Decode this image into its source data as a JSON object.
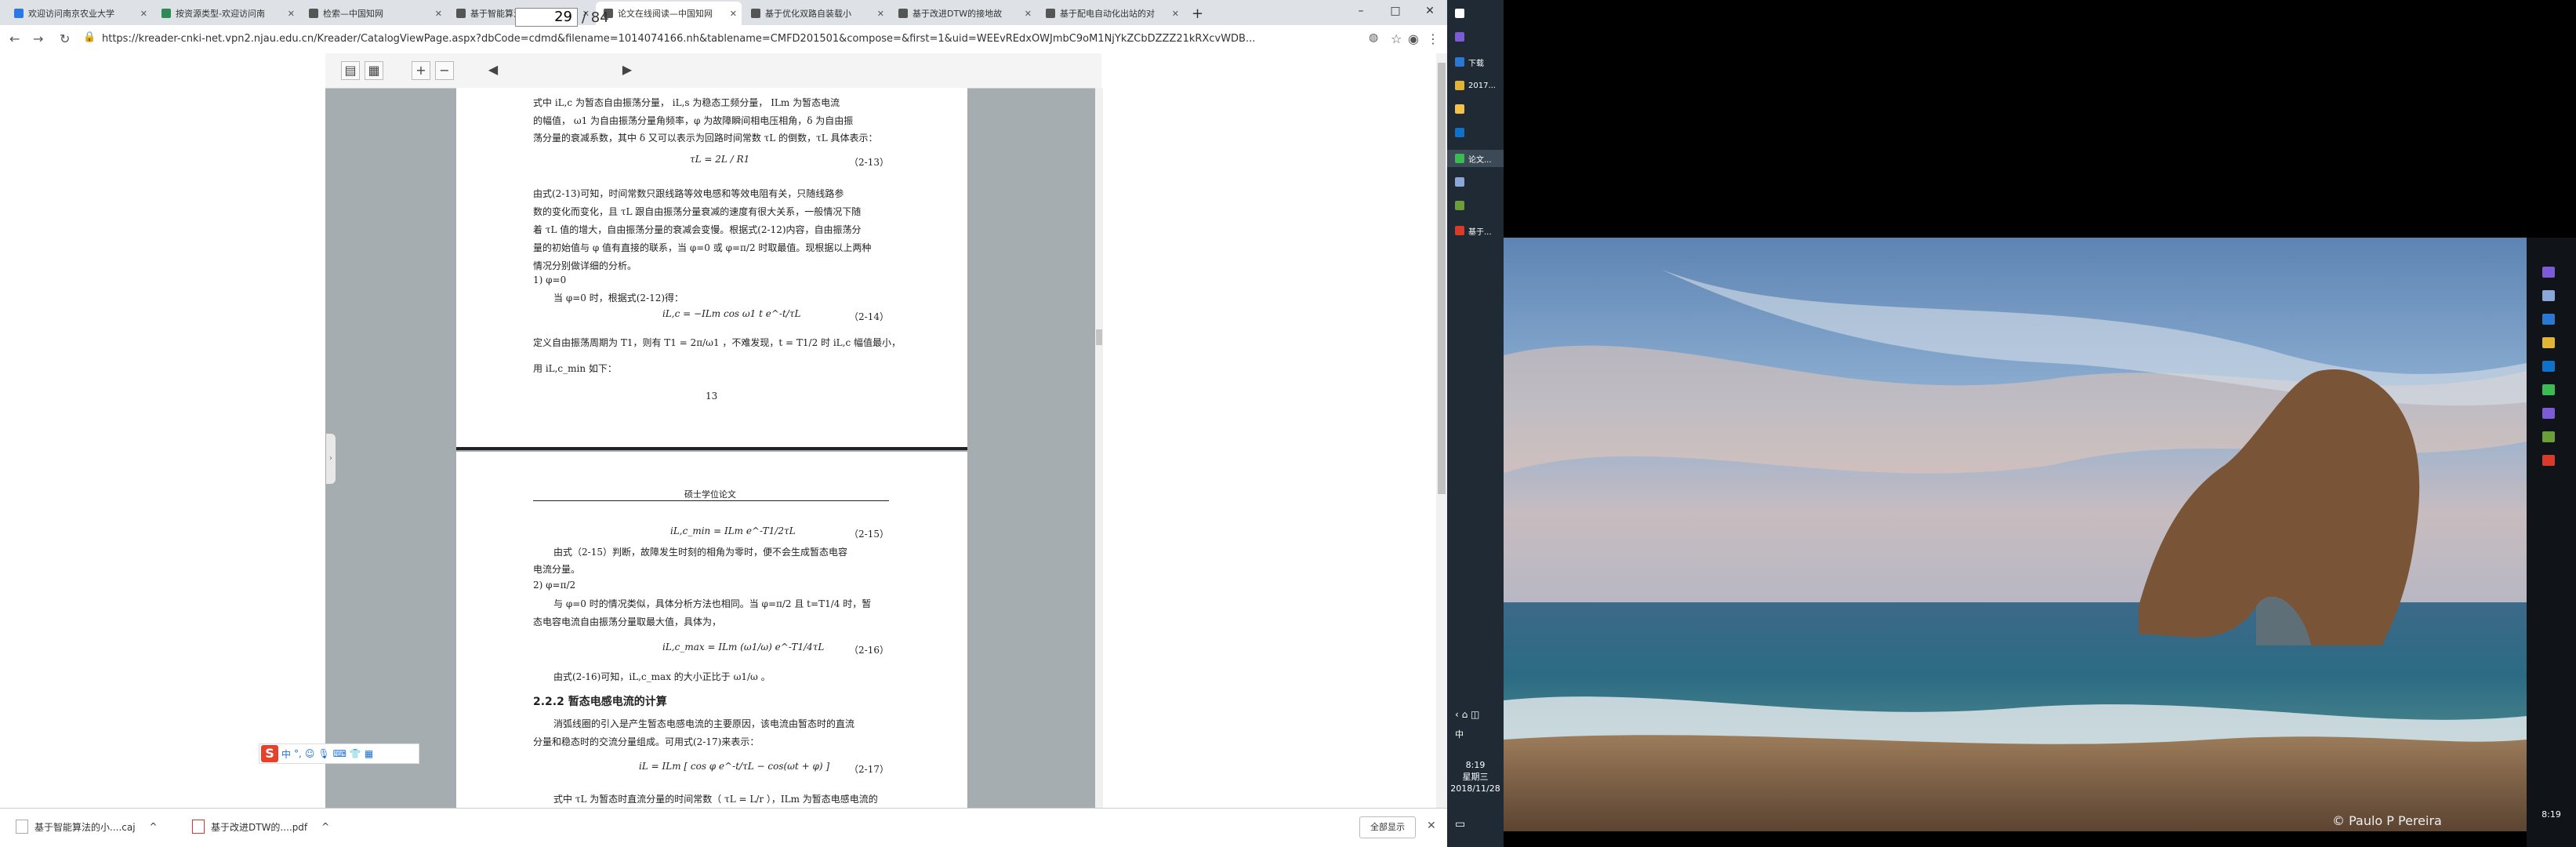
{
  "browser": {
    "tabs": [
      {
        "label": "欢迎访问南京农业大学",
        "color": "#2b78e4"
      },
      {
        "label": "按资源类型-欢迎访问南",
        "color": "#2e8b57"
      },
      {
        "label": "检索—中国知网",
        "color": "#555555"
      },
      {
        "label": "基于智能算法的小电流接",
        "color": "#555555"
      },
      {
        "label": "论文在线阅读—中国知网",
        "color": "#555555",
        "active": true
      },
      {
        "label": "基于优化双路自装载小",
        "color": "#555555"
      },
      {
        "label": "基于改进DTW的接地故",
        "color": "#555555"
      },
      {
        "label": "基于配电自动化出站的对",
        "color": "#555555"
      }
    ],
    "new_tab": "+",
    "window_controls": [
      "–",
      "□",
      "✕"
    ],
    "url": "https://kreader-cnki-net.vpn2.njau.edu.cn/Kreader/CatalogViewPage.aspx?dbCode=cdmd&filename=1014074166.nh&tablename=CMFD201501&compose=&first=1&uid=WEEvREdxOWJmbC9oM1NjYkZCbDZZZ21kRXcvWDB..."
  },
  "reader": {
    "current_page": "29",
    "total_pages": "/ 84"
  },
  "page1": {
    "lines": [
      "式中 iL,c 为暂态自由振荡分量， iL,s 为稳态工频分量， ILm 为暂态电流",
      "的幅值， ω1 为自由振荡分量角频率，φ 为故障瞬间相电压相角，δ 为自由振",
      "荡分量的衰减系数，其中 δ 又可以表示为回路时间常数 τL 的倒数，τL 具体表示：",
      "由式(2-13)可知，时间常数只跟线路等效电感和等效电阻有关，只随线路参",
      "数的变化而变化，且 τL 跟自由振荡分量衰减的速度有很大关系，一般情况下随",
      "着 τL 值的增大，自由振荡分量的衰减会变慢。根据式(2-12)内容，自由振荡分",
      "量的初始值与 φ 值有直接的联系，当 φ=0 或 φ=π/2 时取最值。现根据以上两种",
      "情况分别做详细的分析。",
      "1)    φ=0",
      "当 φ=0 时，根据式(2-12)得：",
      "定义自由振荡周期为 T1，则有 T1 = 2π/ω1 ，不难发现，t = T1/2 时 iL,c 幅值最小，",
      "用 iL,c_min 如下："
    ],
    "eq13": "τL = 2L / R1",
    "eq13_no": "（2-13）",
    "eq14": "iL,c = −ILm cos ω1 t e^-t/τL",
    "eq14_no": "（2-14）",
    "page_number": "13"
  },
  "page2": {
    "header": "硕士学位论文",
    "eq15": "iL,c_min = ILm e^-T1/2τL",
    "eq15_no": "（2-15）",
    "lines": [
      "由式（2-15）判断，故障发生时刻的相角为零时，便不会生成暂态电容",
      "电流分量。",
      "2)    φ=π/2",
      "与 φ=0 时的情况类似，具体分析方法也相同。当 φ=π/2 且 t=T1/4 时，暂",
      "态电容电流自由振荡分量取最大值，具体为，",
      "由式(2-16)可知，iL,c_max 的大小正比于 ω1/ω 。",
      "2.2.2  暂态电感电流的计算",
      "消弧线圈的引入是产生暂态电感电流的主要原因，该电流由暂态时的直流",
      "分量和稳态时的交流分量组成。可用式(2-17)来表示：",
      "式中 τL 为暂态时直流分量的时间常数（ τL = L/r ），ILm 为暂态电感电流的"
    ],
    "eq16": "iL,c_max = ILm (ω1/ω) e^-T1/4τL",
    "eq16_no": "（2-16）",
    "eq17": "iL = ILm [ cos φ e^-t/τL − cos(ωt + φ) ]",
    "eq17_no": "（2-17）"
  },
  "ime": {
    "logo": "S",
    "mode": "中"
  },
  "downloads": [
    {
      "name": "基于智能算法的小....caj"
    },
    {
      "name": "基于改进DTW的....pdf"
    }
  ],
  "downloads_showall": "全部显示",
  "taskbar": {
    "items": [
      {
        "label": "",
        "color": "#ffffff"
      },
      {
        "label": "",
        "color": "#7b5cd6"
      },
      {
        "label": "下载",
        "color": "#2a78d2"
      },
      {
        "label": "2017...",
        "color": "#e0b437"
      },
      {
        "label": "",
        "color": "#f2c14e"
      },
      {
        "label": "",
        "color": "#0f71c9"
      },
      {
        "label": "论文...",
        "color": "#3cba54",
        "selected": true
      },
      {
        "label": "",
        "color": "#8ba7d8"
      },
      {
        "label": "",
        "color": "#6b9e3a"
      },
      {
        "label": "基于...",
        "color": "#d83b2a"
      }
    ],
    "lang": "中",
    "time": "8:19",
    "weekday": "星期三",
    "date": "2018/11/28"
  },
  "right_monitor": {
    "credit": "© Paulo P Pereira",
    "time": "8:19",
    "icon_colors": [
      "#7b5cd6",
      "#8ba7d8",
      "#2a78d2",
      "#e0b437",
      "#0f71c9",
      "#3cba54",
      "#7b5cd6",
      "#6b9e3a",
      "#d83b2a"
    ]
  }
}
